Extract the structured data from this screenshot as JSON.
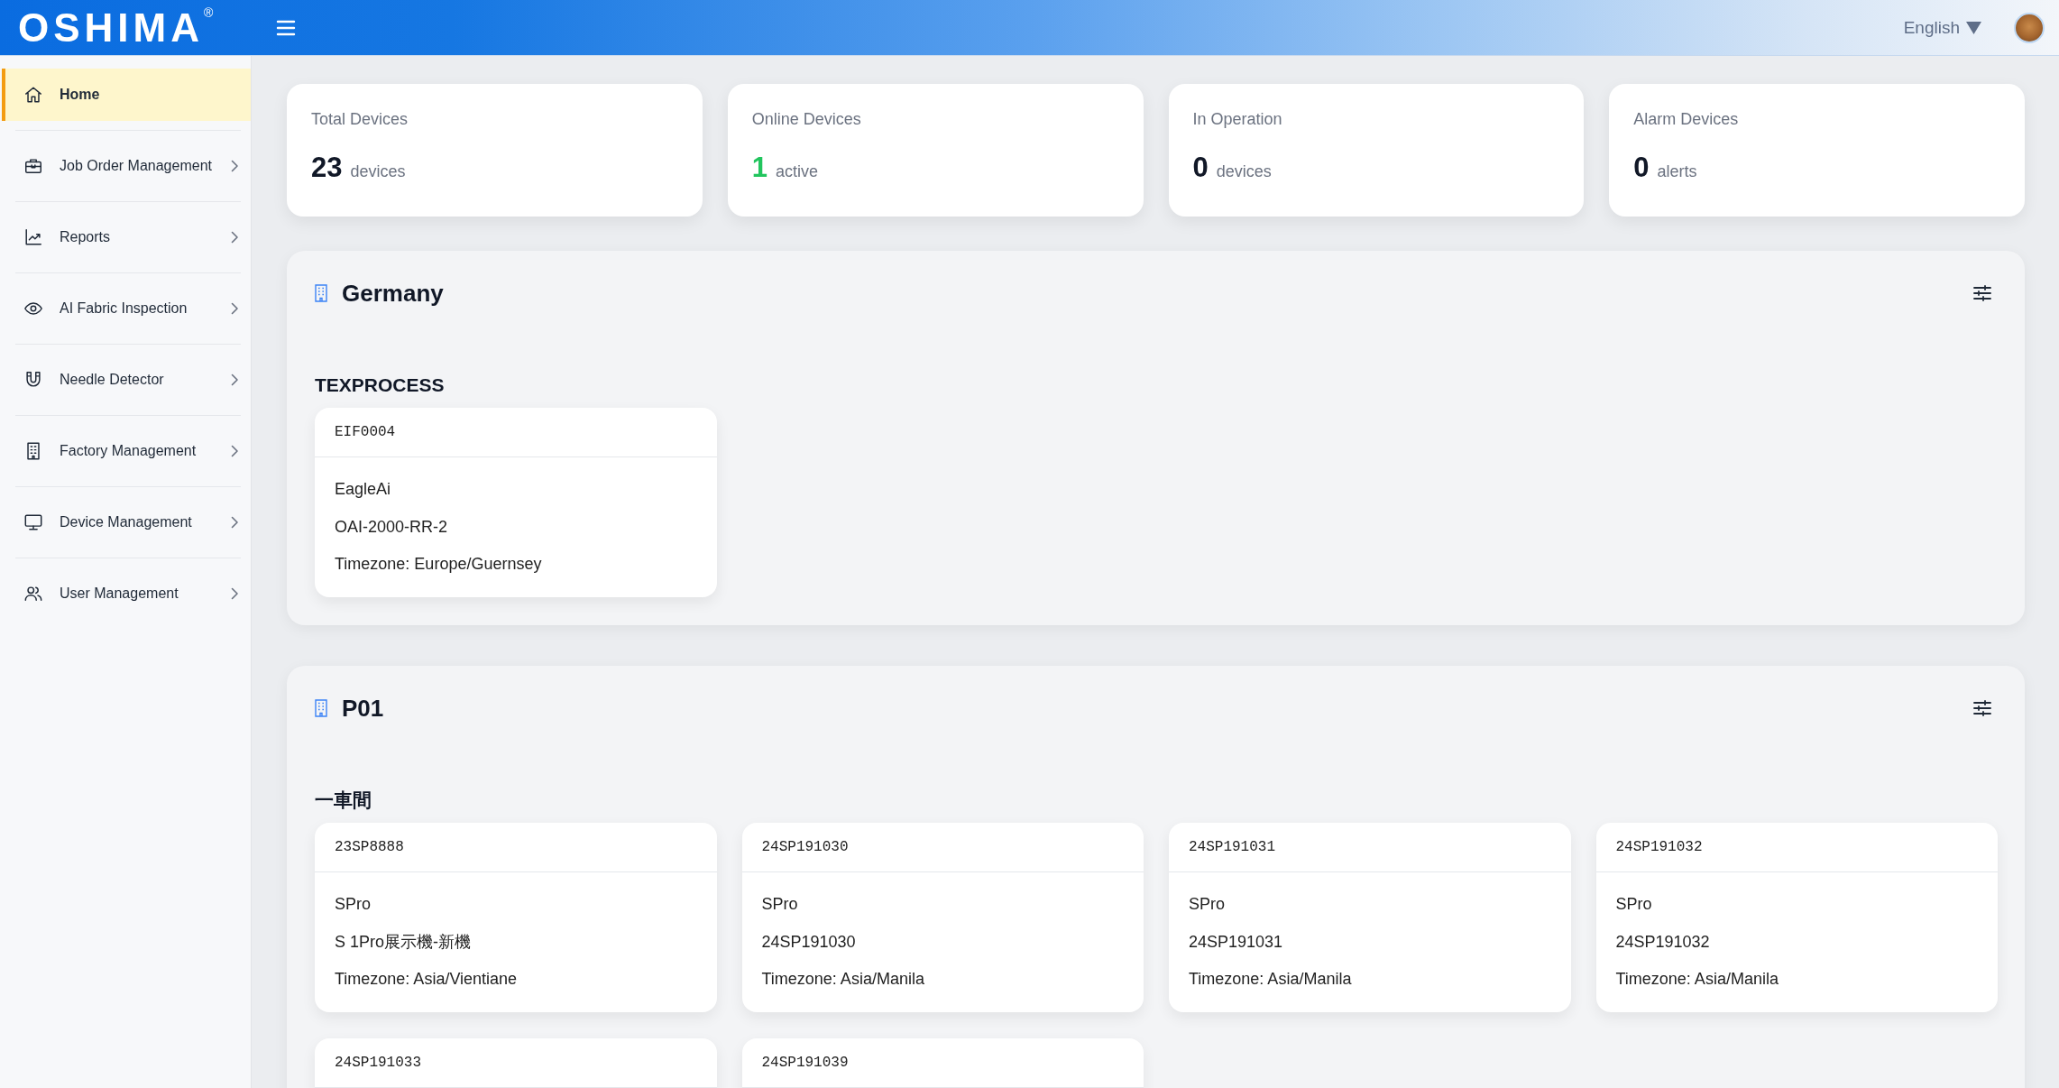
{
  "header": {
    "logo": "OSHIMA$^{®}$",
    "language": "English"
  },
  "sidebar": {
    "items": [
      {
        "label": "Home",
        "selected": true,
        "expandable": false
      },
      {
        "label": "Job Order Management",
        "selected": false,
        "expandable": true
      },
      {
        "label": "Reports",
        "selected": false,
        "expandable": true
      },
      {
        "label": "AI Fabric Inspection",
        "selected": false,
        "expandable": true
      },
      {
        "label": "Needle Detector",
        "selected": false,
        "expandable": true
      },
      {
        "label": "Factory Management",
        "selected": false,
        "expandable": true
      },
      {
        "label": "Device Management",
        "selected": false,
        "expandable": true
      },
      {
        "label": "User Management",
        "selected": false,
        "expandable": true
      }
    ]
  },
  "stats": [
    {
      "label": "Total Devices",
      "value": "23",
      "unit": "devices",
      "color": "#111827"
    },
    {
      "label": "Online Devices",
      "value": "1",
      "unit": "active",
      "color": "#22c55e"
    },
    {
      "label": "In Operation",
      "value": "0",
      "unit": "devices",
      "color": "#111827"
    },
    {
      "label": "Alarm Devices",
      "value": "0",
      "unit": "alerts",
      "color": "#111827"
    }
  ],
  "sites": [
    {
      "title": "Germany",
      "groups": [
        {
          "name": "TEXPROCESS",
          "devices": [
            {
              "id": "EIF0004",
              "details": [
                "EagleAi",
                "OAI-2000-RR-2",
                "Timezone: Europe/Guernsey"
              ]
            }
          ]
        }
      ]
    },
    {
      "title": "P01",
      "groups": [
        {
          "name": "一車間",
          "devices": [
            {
              "id": "23SP8888",
              "details": [
                "SPro",
                "S 1Pro展示機-新機",
                "Timezone: Asia/Vientiane"
              ]
            },
            {
              "id": "24SP191030",
              "details": [
                "SPro",
                "24SP191030",
                "Timezone: Asia/Manila"
              ]
            },
            {
              "id": "24SP191031",
              "details": [
                "SPro",
                "24SP191031",
                "Timezone: Asia/Manila"
              ]
            },
            {
              "id": "24SP191032",
              "details": [
                "SPro",
                "24SP191032",
                "Timezone: Asia/Manila"
              ]
            },
            {
              "id": "24SP191033"
            },
            {
              "id": "24SP191039"
            }
          ]
        }
      ]
    }
  ]
}
